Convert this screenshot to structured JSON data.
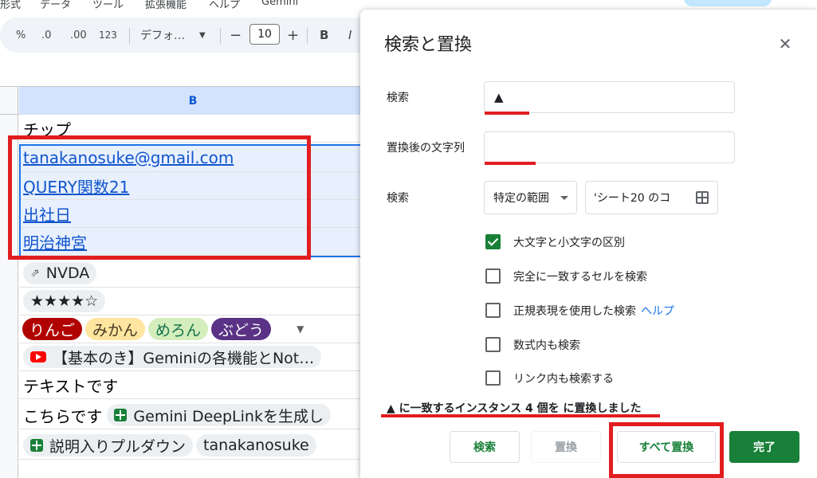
{
  "menu": [
    "形式",
    "データ",
    "ツール",
    "拡張機能",
    "ヘルプ",
    "Gemini"
  ],
  "toolbar": {
    "percent": "%",
    "dec_decrease": ".0",
    "dec_increase": ".00",
    "number_format": "123",
    "font": "デフォ…",
    "minus": "−",
    "font_size": "10",
    "plus": "+",
    "bold": "B",
    "italic": "I"
  },
  "sheet": {
    "column_header": "B",
    "rows": {
      "r1": "チップ",
      "r2": "tanakanosuke@gmail.com",
      "r3": "QUERY関数21",
      "r4": "出社日",
      "r5": "明治神宮",
      "r6": "NVDA",
      "r7": "★★★★☆",
      "r8_chips": [
        "りんご",
        "みかん",
        "めろん",
        "ぶどう"
      ],
      "r9": "【基本のき】Geminiの各機能とNot…",
      "r10": "テキストです",
      "r11_prefix": "こちらです",
      "r11_chip": "Gemini DeepLinkを生成し",
      "r12_chip1": "説明入りプルダウン",
      "r12_chip2": "tanakanosuke"
    }
  },
  "dialog": {
    "title": "検索と置換",
    "find_label": "検索",
    "find_value": "▲",
    "replace_label": "置換後の文字列",
    "replace_value": "",
    "scope_label": "検索",
    "scope_select": "特定の範囲",
    "scope_range": "'シート20 のコ",
    "checkboxes": [
      {
        "label": "大文字と小文字の区別",
        "checked": true
      },
      {
        "label": "完全に一致するセルを検索",
        "checked": false
      },
      {
        "label": "正規表現を使用した検索",
        "checked": false
      },
      {
        "label": "数式内も検索",
        "checked": false
      },
      {
        "label": "リンク内も検索する",
        "checked": false
      }
    ],
    "help_link": "ヘルプ",
    "status": "▲ に一致するインスタンス 4 個を に置換しました",
    "buttons": {
      "find": "検索",
      "replace": "置換",
      "replace_all": "すべて置換",
      "done": "完了"
    }
  },
  "colors": {
    "accent_green": "#188038",
    "annotation_red": "#e11d20",
    "link_blue": "#1155cc"
  }
}
